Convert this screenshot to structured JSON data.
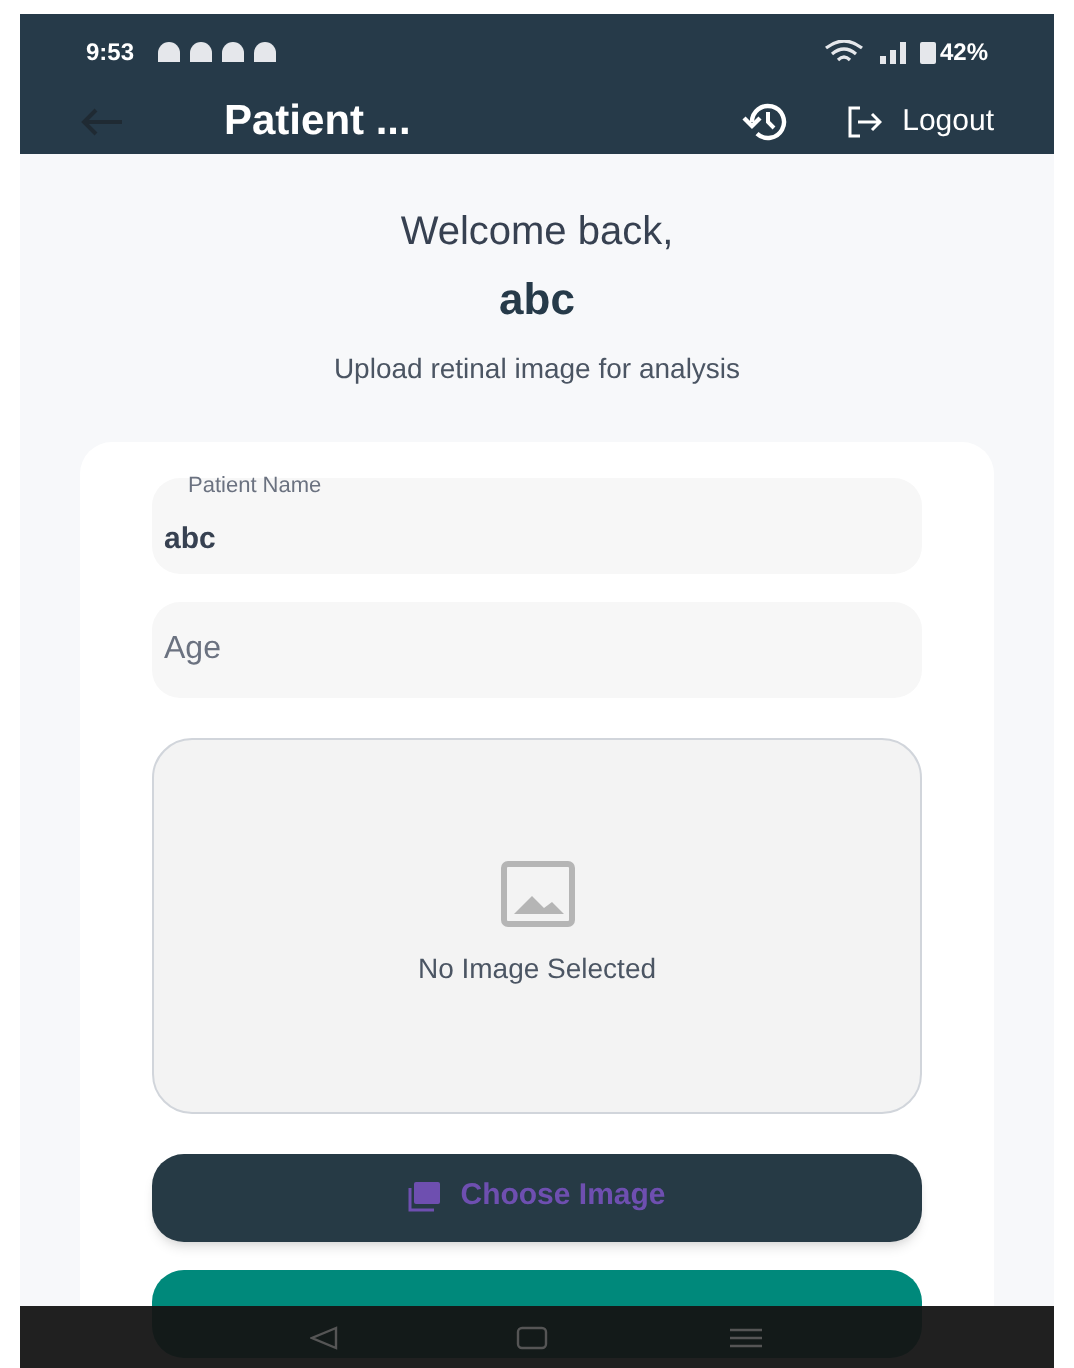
{
  "status_bar": {
    "time": "9:53",
    "battery": "42%"
  },
  "app_bar": {
    "title": "Patient ...",
    "logout": "Logout"
  },
  "welcome": {
    "greeting": "Welcome back,",
    "name": "abc",
    "subtitle": "Upload retinal image for analysis"
  },
  "fields": [
    {
      "label": "Patient Name",
      "value": "abc"
    },
    {
      "placeholder": "Age"
    }
  ],
  "image_area": {
    "text": "No Image Selected"
  },
  "buttons": [
    {
      "label": "Choose Image",
      "kind": "choose"
    },
    {
      "kind": "analyze"
    }
  ]
}
